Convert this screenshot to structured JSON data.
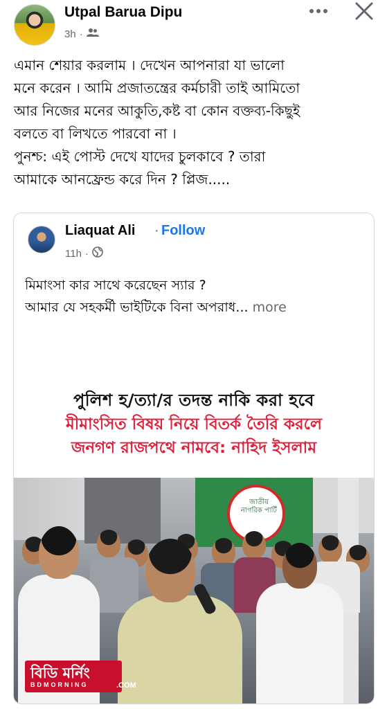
{
  "post": {
    "author": "Utpal Barua Dipu",
    "time": "3h",
    "dot": "·",
    "audience_icon": "friends-icon",
    "text_lines": [
      "এমান শেয়ার করলাম । দেখেন আপনারা যা ভালো",
      "মনে করেন । আমি প্রজাতন্ত্রের কর্মচারী তাই আমিতো",
      "আর নিজের মনের আকুতি,কষ্ট বা কোন বক্তব্য-কিছুই",
      "বলতে বা লিখতে পারবো না ।",
      "পুনশ্চ: এই পোস্ট দেখে যাদের চুলকাবে ? তারা",
      "আমাকে আনফ্রেন্ড করে দিন ? প্লিজ....."
    ]
  },
  "shared": {
    "author": "Liaquat Ali",
    "dot": "·",
    "follow": "Follow",
    "time": "11h",
    "audience_icon": "globe-icon",
    "text_line_1": "মিমাংসা কার সাথে করেছেন স্যার ?",
    "text_line_2": "আমার যে সহকর্মী ভাইটিকে বিনা অপরাধ...",
    "see_more": "more"
  },
  "image": {
    "headline_1": "পুলিশ হ/ত্যা/র তদন্ত নাকি করা হবে",
    "headline_2": "মীমাংসিত বিষয় নিয়ে বিতর্ক তৈরি করলে",
    "headline_3": "জনগণ রাজপথে নামবে: নাহিদ ইসলাম",
    "sign_text": "জাতীয় নাগরিক পার্টি",
    "brand_main": "বিডি মর্নিং",
    "brand_sub": "BDMORNING",
    "brand_com": ".COM"
  },
  "colors": {
    "accent": "#1877f2",
    "headline_red": "#e0203a",
    "secondary_text": "#65676b"
  }
}
